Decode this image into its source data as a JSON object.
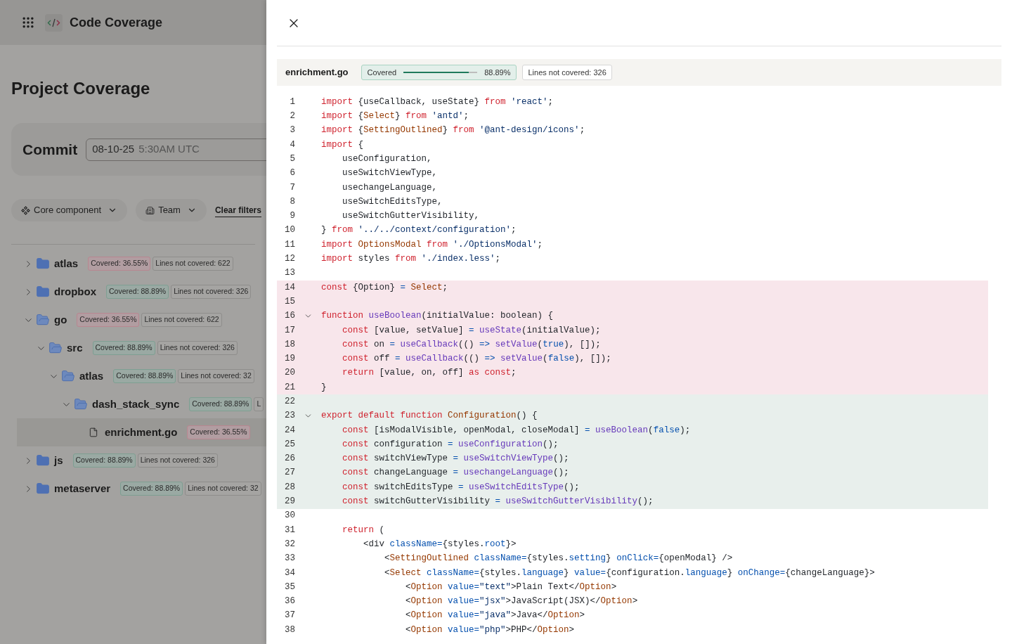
{
  "header": {
    "title": "Code Coverage"
  },
  "page": {
    "title": "Project Coverage",
    "commit": {
      "label": "Commit",
      "date": "08-10-25",
      "time": "5:30AM UTC"
    },
    "filters": [
      {
        "kind": "component",
        "label": "Core component"
      },
      {
        "kind": "team",
        "label": "Team"
      }
    ],
    "clear_filters": "Clear filters",
    "tree": [
      {
        "name": "atlas",
        "kind": "folder",
        "expanded": false,
        "selected": false,
        "low_coverage": true,
        "covered": "Covered: 36.55%",
        "not_covered": "Lines not covered: 622"
      },
      {
        "name": "dropbox",
        "kind": "folder",
        "expanded": false,
        "selected": false,
        "low_coverage": false,
        "covered": "Covered: 88.89%",
        "not_covered": "Lines not covered: 326"
      },
      {
        "name": "go",
        "kind": "folder",
        "expanded": true,
        "selected": false,
        "low_coverage": true,
        "covered": "Covered: 36.55%",
        "not_covered": "Lines not covered: 622",
        "children": [
          {
            "name": "src",
            "kind": "folder",
            "expanded": true,
            "selected": false,
            "low_coverage": false,
            "covered": "Covered: 88.89%",
            "not_covered": "Lines not covered: 326",
            "children": [
              {
                "name": "atlas",
                "kind": "folder",
                "expanded": true,
                "selected": false,
                "low_coverage": false,
                "covered": "Covered: 88.89%",
                "not_covered": "Lines not covered: 32",
                "children": [
                  {
                    "name": "dash_stack_sync",
                    "kind": "folder",
                    "expanded": true,
                    "selected": false,
                    "low_coverage": false,
                    "covered": "Covered: 88.89%",
                    "not_covered": "L",
                    "children": [
                      {
                        "name": "enrichment.go",
                        "kind": "file",
                        "selected": true,
                        "low_coverage": true,
                        "covered": "Covered: 36.55%"
                      }
                    ]
                  }
                ]
              }
            ]
          }
        ]
      },
      {
        "name": "js",
        "kind": "folder",
        "expanded": false,
        "selected": false,
        "low_coverage": false,
        "covered": "Covered: 88.89%",
        "not_covered": "Lines not covered: 326"
      },
      {
        "name": "metaserver",
        "kind": "folder",
        "expanded": false,
        "selected": false,
        "low_coverage": false,
        "covered": "Covered: 88.89%",
        "not_covered": "Lines not covered: 32"
      }
    ]
  },
  "drawer": {
    "file": {
      "name": "enrichment.go",
      "covered_label": "Covered",
      "level": 0.8889,
      "percent": "88.89%",
      "lines_not_covered": "Lines not covered: 326"
    },
    "lines": [
      {
        "number": "1",
        "kind": "plain",
        "foldable": false,
        "tokens": [
          {
            "kind": "kw",
            "text": "import"
          },
          {
            "kind": "p",
            "text": " {useCallback, useState} "
          },
          {
            "kind": "kw",
            "text": "from"
          },
          {
            "kind": "str",
            "text": " 'react'"
          },
          {
            "kind": "p",
            "text": ";"
          }
        ]
      },
      {
        "number": "2",
        "kind": "plain",
        "foldable": false,
        "tokens": [
          {
            "kind": "kw",
            "text": "import"
          },
          {
            "kind": "p",
            "text": " {"
          },
          {
            "kind": "type",
            "text": "Select"
          },
          {
            "kind": "p",
            "text": "} "
          },
          {
            "kind": "kw",
            "text": "from"
          },
          {
            "kind": "str",
            "text": " 'antd'"
          },
          {
            "kind": "p",
            "text": ";"
          }
        ]
      },
      {
        "number": "3",
        "kind": "plain",
        "foldable": false,
        "tokens": [
          {
            "kind": "kw",
            "text": "import"
          },
          {
            "kind": "p",
            "text": " {"
          },
          {
            "kind": "type",
            "text": "SettingOutlined"
          },
          {
            "kind": "p",
            "text": "} "
          },
          {
            "kind": "kw",
            "text": "from"
          },
          {
            "kind": "str",
            "text": " '@ant-design/icons'"
          },
          {
            "kind": "p",
            "text": ";"
          }
        ]
      },
      {
        "number": "4",
        "kind": "plain",
        "foldable": false,
        "tokens": [
          {
            "kind": "kw",
            "text": "import"
          },
          {
            "kind": "p",
            "text": " {"
          }
        ]
      },
      {
        "number": "5",
        "kind": "plain",
        "foldable": false,
        "tokens": [
          {
            "kind": "p",
            "text": "    useConfiguration,"
          }
        ]
      },
      {
        "number": "6",
        "kind": "plain",
        "foldable": false,
        "tokens": [
          {
            "kind": "p",
            "text": "    useSwitchViewType,"
          }
        ]
      },
      {
        "number": "7",
        "kind": "plain",
        "foldable": false,
        "tokens": [
          {
            "kind": "p",
            "text": "    usechangeLanguage,"
          }
        ]
      },
      {
        "number": "8",
        "kind": "plain",
        "foldable": false,
        "tokens": [
          {
            "kind": "p",
            "text": "    useSwitchEditsType,"
          }
        ]
      },
      {
        "number": "9",
        "kind": "plain",
        "foldable": false,
        "tokens": [
          {
            "kind": "p",
            "text": "    useSwitchGutterVisibility,"
          }
        ]
      },
      {
        "number": "10",
        "kind": "plain",
        "foldable": false,
        "tokens": [
          {
            "kind": "p",
            "text": "} "
          },
          {
            "kind": "kw",
            "text": "from"
          },
          {
            "kind": "str",
            "text": " '../../context/configuration'"
          },
          {
            "kind": "p",
            "text": ";"
          }
        ]
      },
      {
        "number": "11",
        "kind": "plain",
        "foldable": false,
        "tokens": [
          {
            "kind": "kw",
            "text": "import"
          },
          {
            "kind": "type",
            "text": " OptionsModal"
          },
          {
            "kind": "kw",
            "text": " from"
          },
          {
            "kind": "str",
            "text": " './OptionsModal'"
          },
          {
            "kind": "p",
            "text": ";"
          }
        ]
      },
      {
        "number": "12",
        "kind": "plain",
        "foldable": false,
        "tokens": [
          {
            "kind": "kw",
            "text": "import"
          },
          {
            "kind": "p",
            "text": " styles "
          },
          {
            "kind": "kw",
            "text": "from"
          },
          {
            "kind": "str",
            "text": " './index.less'"
          },
          {
            "kind": "p",
            "text": ";"
          }
        ]
      },
      {
        "number": "13",
        "kind": "plain",
        "foldable": false
      },
      {
        "number": "14",
        "kind": "uncovered",
        "foldable": false,
        "tokens": [
          {
            "kind": "kw",
            "text": "const"
          },
          {
            "kind": "p",
            "text": " {Option} "
          },
          {
            "kind": "op",
            "text": "="
          },
          {
            "kind": "type",
            "text": " Select"
          },
          {
            "kind": "p",
            "text": ";"
          }
        ]
      },
      {
        "number": "15",
        "kind": "uncovered",
        "foldable": false
      },
      {
        "number": "16",
        "kind": "uncovered",
        "foldable": true,
        "tokens": [
          {
            "kind": "kw",
            "text": "function"
          },
          {
            "kind": "fn",
            "text": " useBoolean"
          },
          {
            "kind": "p",
            "text": "(initialValue: boolean) {"
          }
        ]
      },
      {
        "number": "17",
        "kind": "uncovered",
        "foldable": false,
        "tokens": [
          {
            "kind": "kw",
            "text": "    const"
          },
          {
            "kind": "p",
            "text": " [value, setValue] "
          },
          {
            "kind": "op",
            "text": "="
          },
          {
            "kind": "fn",
            "text": " useState"
          },
          {
            "kind": "p",
            "text": "(initialValue);"
          }
        ]
      },
      {
        "number": "18",
        "kind": "uncovered",
        "foldable": false,
        "tokens": [
          {
            "kind": "kw",
            "text": "    const"
          },
          {
            "kind": "p",
            "text": " on "
          },
          {
            "kind": "op",
            "text": "="
          },
          {
            "kind": "fn",
            "text": " useCallback"
          },
          {
            "kind": "p",
            "text": "(() "
          },
          {
            "kind": "op",
            "text": "=>"
          },
          {
            "kind": "fn",
            "text": " setValue"
          },
          {
            "kind": "p",
            "text": "("
          },
          {
            "kind": "op",
            "text": "true"
          },
          {
            "kind": "p",
            "text": "), []);"
          }
        ]
      },
      {
        "number": "19",
        "kind": "uncovered",
        "foldable": false,
        "tokens": [
          {
            "kind": "kw",
            "text": "    const"
          },
          {
            "kind": "p",
            "text": " off "
          },
          {
            "kind": "op",
            "text": "="
          },
          {
            "kind": "fn",
            "text": " useCallback"
          },
          {
            "kind": "p",
            "text": "(() "
          },
          {
            "kind": "op",
            "text": "=>"
          },
          {
            "kind": "fn",
            "text": " setValue"
          },
          {
            "kind": "p",
            "text": "("
          },
          {
            "kind": "op",
            "text": "false"
          },
          {
            "kind": "p",
            "text": "), []);"
          }
        ]
      },
      {
        "number": "20",
        "kind": "uncovered",
        "foldable": false,
        "tokens": [
          {
            "kind": "kw",
            "text": "    return"
          },
          {
            "kind": "p",
            "text": " [value, on, off] "
          },
          {
            "kind": "kw",
            "text": "as const"
          },
          {
            "kind": "p",
            "text": ";"
          }
        ]
      },
      {
        "number": "21",
        "kind": "uncovered",
        "foldable": false,
        "tokens": [
          {
            "kind": "p",
            "text": "}"
          }
        ]
      },
      {
        "number": "22",
        "kind": "covered",
        "foldable": false
      },
      {
        "number": "23",
        "kind": "covered",
        "foldable": true,
        "tokens": [
          {
            "kind": "kw",
            "text": "export default function"
          },
          {
            "kind": "type",
            "text": " Configuration"
          },
          {
            "kind": "p",
            "text": "() {"
          }
        ]
      },
      {
        "number": "24",
        "kind": "covered",
        "foldable": false,
        "tokens": [
          {
            "kind": "kw",
            "text": "    const"
          },
          {
            "kind": "p",
            "text": " [isModalVisible, openModal, closeModal] "
          },
          {
            "kind": "op",
            "text": "="
          },
          {
            "kind": "fn",
            "text": " useBoolean"
          },
          {
            "kind": "p",
            "text": "("
          },
          {
            "kind": "op",
            "text": "false"
          },
          {
            "kind": "p",
            "text": ");"
          }
        ]
      },
      {
        "number": "25",
        "kind": "covered",
        "foldable": false,
        "tokens": [
          {
            "kind": "kw",
            "text": "    const"
          },
          {
            "kind": "p",
            "text": " configuration "
          },
          {
            "kind": "op",
            "text": "="
          },
          {
            "kind": "fn",
            "text": " useConfiguration"
          },
          {
            "kind": "p",
            "text": "();"
          }
        ]
      },
      {
        "number": "26",
        "kind": "covered",
        "foldable": false,
        "tokens": [
          {
            "kind": "kw",
            "text": "    const"
          },
          {
            "kind": "p",
            "text": " switchViewType "
          },
          {
            "kind": "op",
            "text": "="
          },
          {
            "kind": "fn",
            "text": " useSwitchViewType"
          },
          {
            "kind": "p",
            "text": "();"
          }
        ]
      },
      {
        "number": "27",
        "kind": "covered",
        "foldable": false,
        "tokens": [
          {
            "kind": "kw",
            "text": "    const"
          },
          {
            "kind": "p",
            "text": " changeLanguage "
          },
          {
            "kind": "op",
            "text": "="
          },
          {
            "kind": "fn",
            "text": " usechangeLanguage"
          },
          {
            "kind": "p",
            "text": "();"
          }
        ]
      },
      {
        "number": "28",
        "kind": "covered",
        "foldable": false,
        "tokens": [
          {
            "kind": "kw",
            "text": "    const"
          },
          {
            "kind": "p",
            "text": " switchEditsType "
          },
          {
            "kind": "op",
            "text": "="
          },
          {
            "kind": "fn",
            "text": " useSwitchEditsType"
          },
          {
            "kind": "p",
            "text": "();"
          }
        ]
      },
      {
        "number": "29",
        "kind": "covered",
        "foldable": false,
        "tokens": [
          {
            "kind": "kw",
            "text": "    const"
          },
          {
            "kind": "p",
            "text": " switchGutterVisibility "
          },
          {
            "kind": "op",
            "text": "="
          },
          {
            "kind": "fn",
            "text": " useSwitchGutterVisibility"
          },
          {
            "kind": "p",
            "text": "();"
          }
        ]
      },
      {
        "number": "30",
        "kind": "plain",
        "foldable": false
      },
      {
        "number": "31",
        "kind": "plain",
        "foldable": false,
        "tokens": [
          {
            "kind": "kw",
            "text": "    return"
          },
          {
            "kind": "p",
            "text": " ("
          }
        ]
      },
      {
        "number": "32",
        "kind": "plain",
        "foldable": false,
        "tokens": [
          {
            "kind": "p",
            "text": "        <div "
          },
          {
            "kind": "op",
            "text": "className="
          },
          {
            "kind": "p",
            "text": "{styles."
          },
          {
            "kind": "op",
            "text": "root"
          },
          {
            "kind": "p",
            "text": "}>"
          }
        ]
      },
      {
        "number": "33",
        "kind": "plain",
        "foldable": false,
        "tokens": [
          {
            "kind": "p",
            "text": "            <"
          },
          {
            "kind": "type",
            "text": "SettingOutlined"
          },
          {
            "kind": "op",
            "text": " className="
          },
          {
            "kind": "p",
            "text": "{styles."
          },
          {
            "kind": "op",
            "text": "setting"
          },
          {
            "kind": "p",
            "text": "} "
          },
          {
            "kind": "op",
            "text": "onClick="
          },
          {
            "kind": "p",
            "text": "{openModal} />"
          }
        ]
      },
      {
        "number": "34",
        "kind": "plain",
        "foldable": false,
        "tokens": [
          {
            "kind": "p",
            "text": "            <"
          },
          {
            "kind": "type",
            "text": "Select"
          },
          {
            "kind": "op",
            "text": " className="
          },
          {
            "kind": "p",
            "text": "{styles."
          },
          {
            "kind": "op",
            "text": "language"
          },
          {
            "kind": "p",
            "text": "} "
          },
          {
            "kind": "op",
            "text": "value="
          },
          {
            "kind": "p",
            "text": "{configuration."
          },
          {
            "kind": "op",
            "text": "language"
          },
          {
            "kind": "p",
            "text": "} "
          },
          {
            "kind": "op",
            "text": "onChange="
          },
          {
            "kind": "p",
            "text": "{changeLanguage}>"
          }
        ]
      },
      {
        "number": "35",
        "kind": "plain",
        "foldable": false,
        "tokens": [
          {
            "kind": "p",
            "text": "                <"
          },
          {
            "kind": "type",
            "text": "Option"
          },
          {
            "kind": "op",
            "text": " value="
          },
          {
            "kind": "str",
            "text": "\"text\""
          },
          {
            "kind": "p",
            "text": ">Plain Text</"
          },
          {
            "kind": "type",
            "text": "Option"
          },
          {
            "kind": "p",
            "text": ">"
          }
        ]
      },
      {
        "number": "36",
        "kind": "plain",
        "foldable": false,
        "tokens": [
          {
            "kind": "p",
            "text": "                <"
          },
          {
            "kind": "type",
            "text": "Option"
          },
          {
            "kind": "op",
            "text": " value="
          },
          {
            "kind": "str",
            "text": "\"jsx\""
          },
          {
            "kind": "p",
            "text": ">JavaScript(JSX)</"
          },
          {
            "kind": "type",
            "text": "Option"
          },
          {
            "kind": "p",
            "text": ">"
          }
        ]
      },
      {
        "number": "37",
        "kind": "plain",
        "foldable": false,
        "tokens": [
          {
            "kind": "p",
            "text": "                <"
          },
          {
            "kind": "type",
            "text": "Option"
          },
          {
            "kind": "op",
            "text": " value="
          },
          {
            "kind": "str",
            "text": "\"java\""
          },
          {
            "kind": "p",
            "text": ">Java</"
          },
          {
            "kind": "type",
            "text": "Option"
          },
          {
            "kind": "p",
            "text": ">"
          }
        ]
      },
      {
        "number": "38",
        "kind": "plain",
        "foldable": false,
        "tokens": [
          {
            "kind": "p",
            "text": "                <"
          },
          {
            "kind": "type",
            "text": "Option"
          },
          {
            "kind": "op",
            "text": " value="
          },
          {
            "kind": "str",
            "text": "\"php\""
          },
          {
            "kind": "p",
            "text": ">PHP</"
          },
          {
            "kind": "type",
            "text": "Option"
          },
          {
            "kind": "p",
            "text": ">"
          }
        ]
      }
    ]
  }
}
